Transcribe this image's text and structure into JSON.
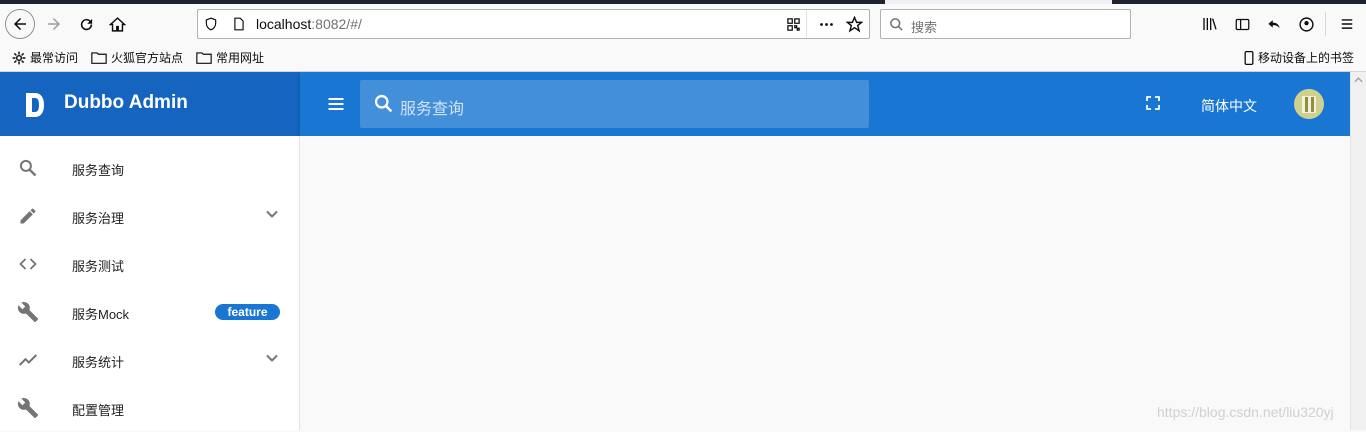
{
  "browser": {
    "url_host": "localhost",
    "url_path": ":8082/#/",
    "search_placeholder": "搜索"
  },
  "bookmarks": {
    "items": [
      "最常访问",
      "火狐官方站点",
      "常用网址"
    ],
    "mobile": "移动设备上的书签"
  },
  "app": {
    "title": "Dubbo Admin",
    "search_placeholder": "服务查询",
    "language": "简体中文",
    "colors": {
      "brand": "#1565c0",
      "appbar": "#1976d2",
      "badge": "#1976d2"
    }
  },
  "sidebar": {
    "items": [
      {
        "label": "服务查询",
        "icon": "search-icon"
      },
      {
        "label": "服务治理",
        "icon": "pencil-icon",
        "expandable": true
      },
      {
        "label": "服务测试",
        "icon": "code-icon"
      },
      {
        "label": "服务Mock",
        "icon": "wrench-icon",
        "badge": "feature"
      },
      {
        "label": "服务统计",
        "icon": "trending-icon",
        "expandable": true
      },
      {
        "label": "配置管理",
        "icon": "wrench-icon"
      }
    ]
  },
  "watermark": "https://blog.csdn.net/liu320yj"
}
